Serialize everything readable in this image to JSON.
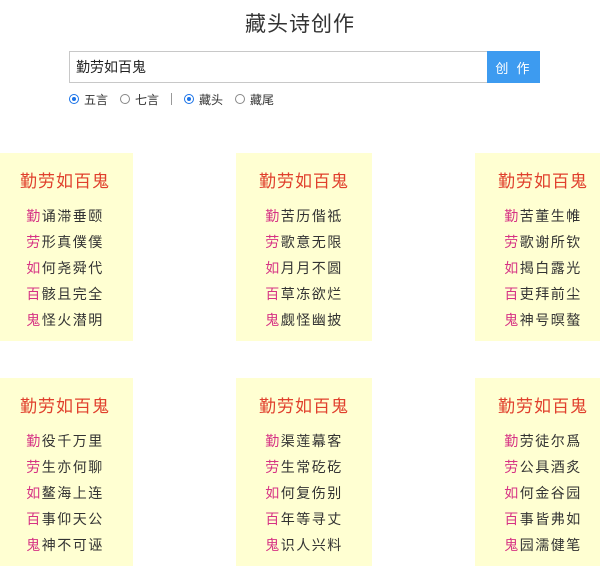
{
  "page": {
    "title": "藏头诗创作"
  },
  "search": {
    "value": "勤劳如百鬼",
    "button_label": "创 作"
  },
  "options": {
    "five": {
      "label": "五言",
      "checked": true
    },
    "seven": {
      "label": "七言",
      "checked": false
    },
    "head": {
      "label": "藏头",
      "checked": true
    },
    "tail": {
      "label": "藏尾",
      "checked": false
    }
  },
  "cards": [
    {
      "title": "勤劳如百鬼",
      "lines": [
        {
          "h": "勤",
          "r": "诵滞垂颐"
        },
        {
          "h": "劳",
          "r": "形真僕僕"
        },
        {
          "h": "如",
          "r": "何尧舜代"
        },
        {
          "h": "百",
          "r": "骸且完全"
        },
        {
          "h": "鬼",
          "r": "怪火潜明"
        }
      ]
    },
    {
      "title": "勤劳如百鬼",
      "lines": [
        {
          "h": "勤",
          "r": "苦历偕祗"
        },
        {
          "h": "劳",
          "r": "歌意无限"
        },
        {
          "h": "如",
          "r": "月月不圆"
        },
        {
          "h": "百",
          "r": "草冻欲烂"
        },
        {
          "h": "鬼",
          "r": "觑怪幽披"
        }
      ]
    },
    {
      "title": "勤劳如百鬼",
      "lines": [
        {
          "h": "勤",
          "r": "苦董生帷"
        },
        {
          "h": "劳",
          "r": "歌谢所钦"
        },
        {
          "h": "如",
          "r": "揭白露光"
        },
        {
          "h": "百",
          "r": "吏拜前尘"
        },
        {
          "h": "鬼",
          "r": "神号暝螯"
        }
      ]
    },
    {
      "title": "勤劳如百鬼",
      "lines": [
        {
          "h": "勤",
          "r": "役千万里"
        },
        {
          "h": "劳",
          "r": "生亦何聊"
        },
        {
          "h": "如",
          "r": "鳌海上连"
        },
        {
          "h": "百",
          "r": "事仰天公"
        },
        {
          "h": "鬼",
          "r": "神不可诬"
        }
      ]
    },
    {
      "title": "勤劳如百鬼",
      "lines": [
        {
          "h": "勤",
          "r": "渠莲幕客"
        },
        {
          "h": "劳",
          "r": "生常矻矻"
        },
        {
          "h": "如",
          "r": "何复伤别"
        },
        {
          "h": "百",
          "r": "年等寻丈"
        },
        {
          "h": "鬼",
          "r": "识人兴料"
        }
      ]
    },
    {
      "title": "勤劳如百鬼",
      "lines": [
        {
          "h": "勤",
          "r": "劳徒尔爲"
        },
        {
          "h": "劳",
          "r": "公具酒炙"
        },
        {
          "h": "如",
          "r": "何金谷园"
        },
        {
          "h": "百",
          "r": "事皆弗如"
        },
        {
          "h": "鬼",
          "r": "园濡健笔"
        }
      ]
    }
  ]
}
